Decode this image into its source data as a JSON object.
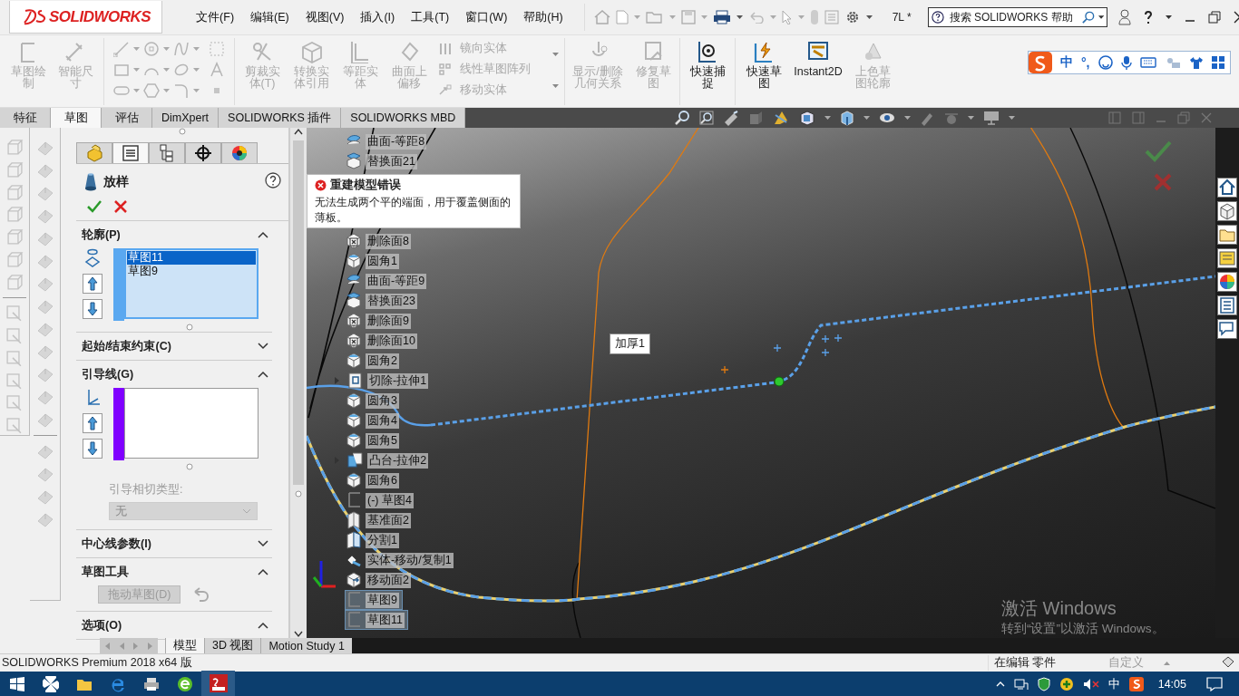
{
  "window": {
    "logo": "SOLIDWORKS",
    "menu": [
      "文件(F)",
      "编辑(E)",
      "视图(V)",
      "插入(I)",
      "工具(T)",
      "窗口(W)",
      "帮助(H)"
    ],
    "document_title": "7L *",
    "search": {
      "placeholder": "搜索 SOLIDWORKS 帮助"
    }
  },
  "ribbon": {
    "sketch_tools": [
      {
        "label": "草图绘制",
        "disabled": true
      },
      {
        "label": "智能尺寸",
        "disabled": true
      }
    ],
    "edit_tools": [
      {
        "label": "剪裁实体(T)",
        "disabled": true
      },
      {
        "label": "转换实体引用",
        "disabled": true
      },
      {
        "label": "等距实体",
        "disabled": true
      },
      {
        "label": "曲面上偏移",
        "disabled": true
      }
    ],
    "pattern_tools": [
      {
        "label": "镜向实体",
        "disabled": true
      },
      {
        "label": "线性草图阵列",
        "disabled": true
      },
      {
        "label": "移动实体",
        "disabled": true
      }
    ],
    "relation_tools": [
      {
        "label": "显示/删除几何关系",
        "disabled": true
      },
      {
        "label": "修复草图",
        "disabled": true
      }
    ],
    "snap_tools": [
      {
        "label": "快速捕捉",
        "disabled": false
      }
    ],
    "view_tools": [
      {
        "label": "快速草图",
        "disabled": false
      },
      {
        "label": "Instant2D",
        "disabled": false
      },
      {
        "label": "上色草图轮廓",
        "disabled": true
      }
    ]
  },
  "ime_bar": {
    "mode": "中",
    "punctuation": "°,"
  },
  "command_tabs": [
    {
      "label": "特征",
      "selected": false
    },
    {
      "label": "草图",
      "selected": true
    },
    {
      "label": "评估",
      "selected": false
    },
    {
      "label": "DimXpert",
      "selected": false
    },
    {
      "label": "SOLIDWORKS 插件",
      "selected": false
    },
    {
      "label": "SOLIDWORKS MBD",
      "selected": false
    }
  ],
  "property_manager": {
    "title": "放样",
    "tabs": [
      {
        "kind": "feature",
        "selected": false
      },
      {
        "kind": "property",
        "selected": true
      },
      {
        "kind": "config",
        "selected": false
      },
      {
        "kind": "target",
        "selected": false
      },
      {
        "kind": "display",
        "selected": false
      }
    ],
    "sections": [
      {
        "kind": "selection_list",
        "title": "轮廓(P)",
        "expanded": true,
        "focused": true,
        "color": "#5aa8f0",
        "items": [
          {
            "label": "草图11",
            "selected": true
          },
          {
            "label": "草图9",
            "selected": false
          }
        ]
      },
      {
        "kind": "group",
        "title": "起始/结束约束(C)",
        "expanded": false
      },
      {
        "kind": "selection_list",
        "title": "引导线(G)",
        "expanded": true,
        "focused": false,
        "color": "#8000ff",
        "tangency": {
          "label": "引导相切类型:",
          "value": "无",
          "disabled": true
        }
      },
      {
        "kind": "group",
        "title": "中心线参数(I)",
        "expanded": false
      },
      {
        "kind": "tools",
        "title": "草图工具",
        "expanded": true,
        "button": {
          "label": "拖动草图(D)",
          "disabled": true
        }
      },
      {
        "kind": "group",
        "title": "选项(O)",
        "expanded": true
      }
    ]
  },
  "feature_tree_top": [
    {
      "label": "曲面-等距8",
      "kind": "offset",
      "expandable": false,
      "selected": false
    },
    {
      "label": "替换面21",
      "kind": "replace",
      "expandable": false,
      "selected": false
    }
  ],
  "error_tooltip": {
    "title": "重建模型错误",
    "message": "无法生成两个平的端面，用于覆盖侧面的薄板。"
  },
  "feature_tree_bottom": [
    {
      "label": "删除面8",
      "kind": "delete",
      "expandable": false,
      "selected": false
    },
    {
      "label": "圆角1",
      "kind": "fillet",
      "expandable": false,
      "selected": false
    },
    {
      "label": "曲面-等距9",
      "kind": "offset",
      "expandable": false,
      "selected": false
    },
    {
      "label": "替换面23",
      "kind": "replace",
      "expandable": false,
      "selected": false
    },
    {
      "label": "删除面9",
      "kind": "delete",
      "expandable": false,
      "selected": false
    },
    {
      "label": "删除面10",
      "kind": "delete",
      "expandable": false,
      "selected": false
    },
    {
      "label": "圆角2",
      "kind": "fillet",
      "expandable": false,
      "selected": false
    },
    {
      "label": "切除-拉伸1",
      "kind": "cut",
      "expandable": true,
      "selected": false
    },
    {
      "label": "圆角3",
      "kind": "fillet",
      "expandable": false,
      "selected": false
    },
    {
      "label": "圆角4",
      "kind": "fillet",
      "expandable": false,
      "selected": false
    },
    {
      "label": "圆角5",
      "kind": "fillet",
      "expandable": false,
      "selected": false
    },
    {
      "label": "凸台-拉伸2",
      "kind": "boss",
      "expandable": true,
      "selected": false
    },
    {
      "label": "圆角6",
      "kind": "fillet",
      "expandable": false,
      "selected": false
    },
    {
      "label": "(-) 草图4",
      "kind": "sketch",
      "expandable": false,
      "selected": false
    },
    {
      "label": "基准面2",
      "kind": "plane",
      "expandable": false,
      "selected": false
    },
    {
      "label": "分割1",
      "kind": "split",
      "expandable": false,
      "selected": false
    },
    {
      "label": "实体-移动/复制1",
      "kind": "move",
      "expandable": false,
      "selected": false
    },
    {
      "label": "移动面2",
      "kind": "move_face",
      "expandable": false,
      "selected": false
    },
    {
      "label": "草图9",
      "kind": "sketch",
      "expandable": false,
      "selected": true
    },
    {
      "label": "草图11",
      "kind": "sketch",
      "expandable": false,
      "selected": true
    }
  ],
  "viewport": {
    "callout": "加厚1",
    "watermark": {
      "title": "激活 Windows",
      "subtitle": "转到“设置”以激活 Windows。"
    }
  },
  "bottom_tabs": [
    {
      "label": "模型",
      "selected": true
    },
    {
      "label": "3D 视图",
      "selected": false
    },
    {
      "label": "Motion Study 1",
      "selected": false
    }
  ],
  "status_bar": {
    "product": "SOLIDWORKS Premium 2018 x64 版",
    "mode": "在编辑 零件",
    "units": "自定义"
  },
  "taskbar": {
    "ime": "中",
    "time": "14:05"
  }
}
